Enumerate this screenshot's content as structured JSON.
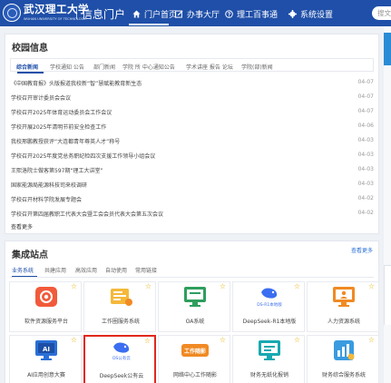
{
  "header": {
    "logo_name": "武汉理工大学",
    "logo_sub": "WUHAN UNIVERSITY OF TECHNOLOGY",
    "portal_title": "信息门户",
    "nav": [
      {
        "label": "门户首页",
        "icon": "home-icon",
        "active": true
      },
      {
        "label": "办事大厅",
        "icon": "edit-icon",
        "active": false
      },
      {
        "label": "理工百事通",
        "icon": "help-circle-icon",
        "active": false
      },
      {
        "label": "系统设置",
        "icon": "gear-icon",
        "active": false
      }
    ],
    "search_placeholder": "搜文件"
  },
  "news": {
    "title": "校园信息",
    "tabs": [
      "综合新闻",
      "学校通知 公告",
      "部门新闻",
      "学院 所 中心通知公告",
      "学术讲座 报告 论坛",
      "学院(部)新闻"
    ],
    "items": [
      {
        "title": "《中国教育报》头版报道我校新“智”慧赋能教育新生态",
        "date": "04-07"
      },
      {
        "title": "学校召开审计委员会会议",
        "date": "04-07"
      },
      {
        "title": "学校召开2025年体育运动委员会工作会议",
        "date": "04-07"
      },
      {
        "title": "学校开展2025年清明节前安全检查工作",
        "date": "04-06"
      },
      {
        "title": "我校邢鹏教授获评“大连都青年尊英人才”称号",
        "date": "04-03"
      },
      {
        "title": "学校召开2025年度党总务职纪检四次支援工作领导小组会议",
        "date": "04-03"
      },
      {
        "title": "王熙洛院士做客第597期“理工大讲堂”",
        "date": "04-03"
      },
      {
        "title": "国家能源局能源科技司来校调研",
        "date": "04-03"
      },
      {
        "title": "学校召开材料学院发展专题会",
        "date": "04-02"
      },
      {
        "title": "学校召开第四届教职工代表大会暨工会会员代表大会第五次会议",
        "date": "04-02"
      }
    ],
    "see_more": "查看更多"
  },
  "sites": {
    "title": "集成站点",
    "more": "查看更多",
    "tabs": [
      "业务系统",
      "共建应用",
      "高效应用",
      "自动使用",
      "常用链接"
    ],
    "tiles": [
      {
        "label": "软件资源服务平台",
        "icon": "software-platform-icon"
      },
      {
        "label": "工作圈服务系统",
        "icon": "work-circle-icon"
      },
      {
        "label": "OA系统",
        "icon": "oa-monitor-icon"
      },
      {
        "label": "DeepSeek-R1本地版",
        "icon": "deepseek-logo-icon",
        "icon_text": "DS-R1本地版"
      },
      {
        "label": "人力资源系统",
        "icon": "hr-monitor-icon"
      },
      {
        "label": "AI应用创意大赛",
        "icon": "ai-badge-icon",
        "icon_text": "AI"
      },
      {
        "label": "DeepSeek公有云",
        "icon": "deepseek-cloud-icon",
        "icon_text": "DS公有云",
        "highlighted": true
      },
      {
        "label": "网络中心工作随影",
        "icon": "work-photo-icon",
        "icon_text": "工作随影"
      },
      {
        "label": "财务无纸化报销",
        "icon": "finance-monitor-icon"
      },
      {
        "label": "财务综合服务系统",
        "icon": "finance-service-icon"
      }
    ]
  },
  "colors": {
    "header_bg": "#1f4fa8",
    "accent": "#1f4fa8",
    "link": "#2a6fd6",
    "highlight_border": "#e0281c",
    "star": "#e3b100"
  }
}
